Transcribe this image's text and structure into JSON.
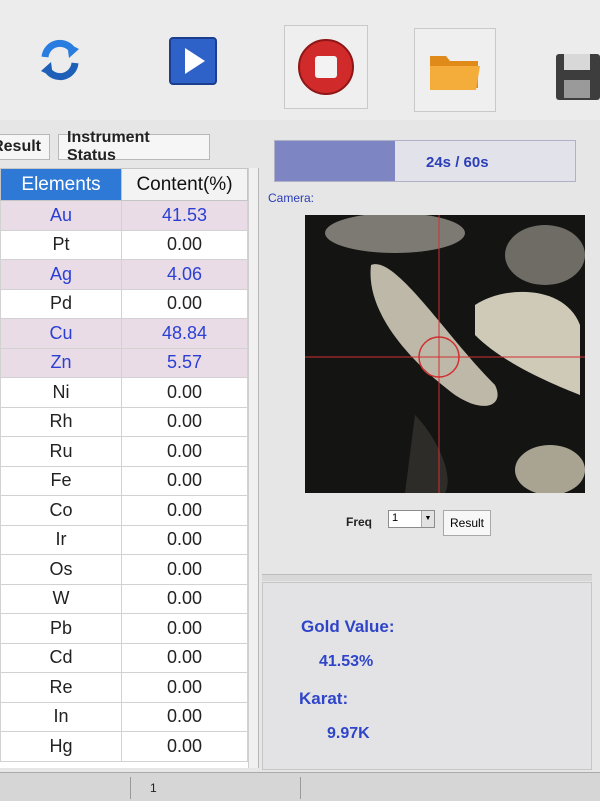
{
  "toolbar": {
    "buttons": [
      {
        "icon": "refresh-icon"
      },
      {
        "icon": "play-icon"
      },
      {
        "icon": "stop-icon"
      },
      {
        "icon": "folder-icon"
      },
      {
        "icon": "save-icon"
      }
    ]
  },
  "tabs": {
    "result": "Result",
    "instrument_status": "Instrument Status"
  },
  "table": {
    "headers": {
      "elements": "Elements",
      "content": "Content(%)"
    },
    "rows": [
      {
        "element": "Au",
        "content": "41.53",
        "highlight": true
      },
      {
        "element": "Pt",
        "content": "0.00",
        "highlight": false
      },
      {
        "element": "Ag",
        "content": "4.06",
        "highlight": true
      },
      {
        "element": "Pd",
        "content": "0.00",
        "highlight": false
      },
      {
        "element": "Cu",
        "content": "48.84",
        "highlight": true
      },
      {
        "element": "Zn",
        "content": "5.57",
        "highlight": true
      },
      {
        "element": "Ni",
        "content": "0.00",
        "highlight": false
      },
      {
        "element": "Rh",
        "content": "0.00",
        "highlight": false
      },
      {
        "element": "Ru",
        "content": "0.00",
        "highlight": false
      },
      {
        "element": "Fe",
        "content": "0.00",
        "highlight": false
      },
      {
        "element": "Co",
        "content": "0.00",
        "highlight": false
      },
      {
        "element": "Ir",
        "content": "0.00",
        "highlight": false
      },
      {
        "element": "Os",
        "content": "0.00",
        "highlight": false
      },
      {
        "element": "W",
        "content": "0.00",
        "highlight": false
      },
      {
        "element": "Pb",
        "content": "0.00",
        "highlight": false
      },
      {
        "element": "Cd",
        "content": "0.00",
        "highlight": false
      },
      {
        "element": "Re",
        "content": "0.00",
        "highlight": false
      },
      {
        "element": "In",
        "content": "0.00",
        "highlight": false
      },
      {
        "element": "Hg",
        "content": "0.00",
        "highlight": false
      }
    ]
  },
  "progress": {
    "text": "24s / 60s",
    "elapsed": 24,
    "total": 60
  },
  "camera": {
    "label": "Camera:"
  },
  "freq": {
    "label": "Freq",
    "value": "1"
  },
  "result_button": "Result",
  "gold": {
    "value_label": "Gold Value:",
    "value": "41.53%",
    "karat_label": "Karat:",
    "karat": "9.97K"
  },
  "status_bar": {
    "page": "1"
  },
  "colors": {
    "accent_blue": "#2f79d6",
    "value_blue": "#2f45c8",
    "highlight_row": "#e9dce6",
    "progress_fill": "#7d86c2"
  }
}
